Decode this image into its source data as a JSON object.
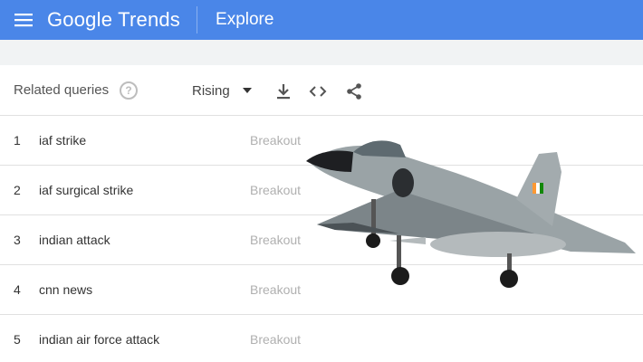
{
  "header": {
    "brand_google": "Google",
    "brand_trends": "Trends",
    "explore_label": "Explore",
    "bar_color": "#4a86e8"
  },
  "related": {
    "title": "Related queries",
    "help_icon": "?",
    "filter_selected": "Rising",
    "tools": [
      "download-icon",
      "embed-code-icon",
      "share-icon"
    ],
    "rows": [
      {
        "rank": "1",
        "query": "iaf strike",
        "value": "Breakout"
      },
      {
        "rank": "2",
        "query": "iaf surgical strike",
        "value": "Breakout"
      },
      {
        "rank": "3",
        "query": "indian attack",
        "value": "Breakout"
      },
      {
        "rank": "4",
        "query": "cnn news",
        "value": "Breakout"
      },
      {
        "rank": "5",
        "query": "indian air force attack",
        "value": "Breakout"
      }
    ]
  }
}
